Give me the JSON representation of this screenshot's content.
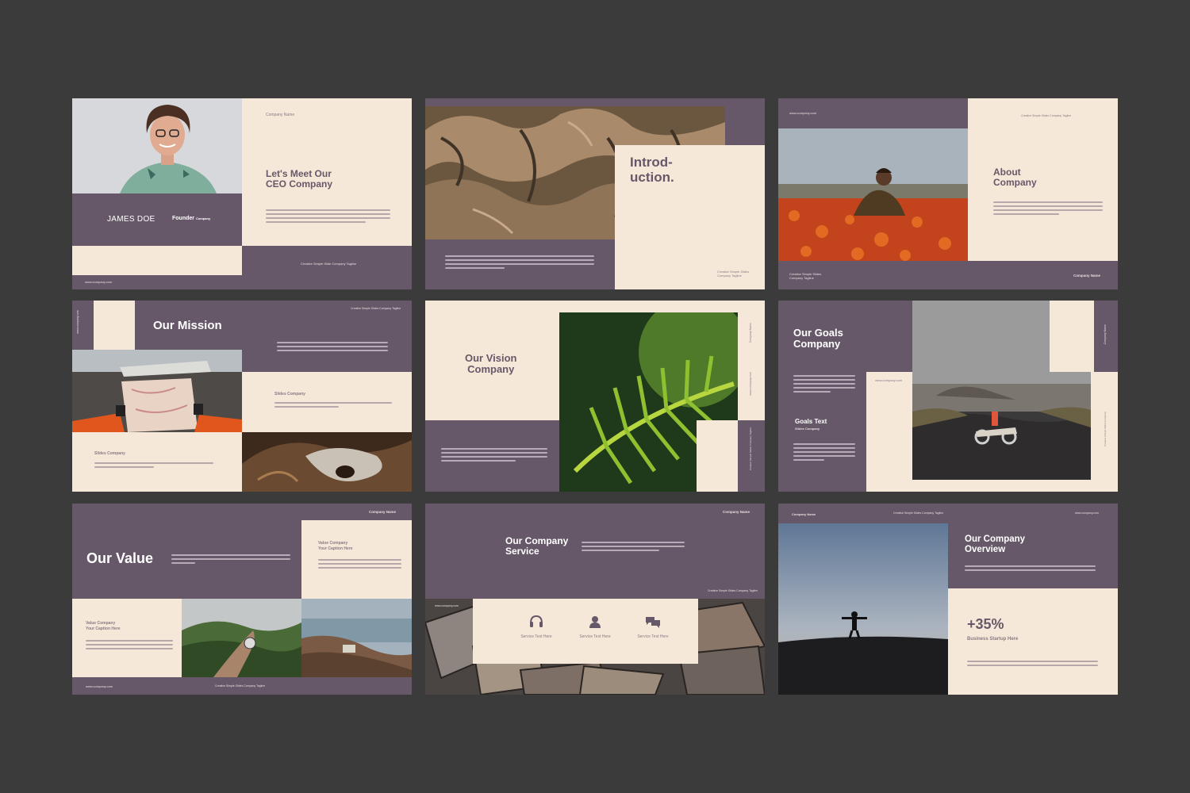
{
  "colors": {
    "background": "#3b3b3b",
    "purple": "#675869",
    "cream": "#f6e8d8"
  },
  "slides": {
    "s1": {
      "company": "Company Name",
      "title_1": "Let's Meet Our",
      "title_2": "CEO Company",
      "name": "JAMES DOE",
      "role": "Founder",
      "role_suffix": "Company",
      "tagline": "Creative Simple Slide Company Tagline",
      "url": "www.company.com"
    },
    "s2": {
      "title_1": "Introd-",
      "title_2": "uction.",
      "tagline_1": "Creative Simple Slides",
      "tagline_2": "Company Tagline"
    },
    "s3": {
      "url": "www.company.com",
      "tagline": "Creative Simple Slides Company Tagline",
      "title_1": "About",
      "title_2": "Company",
      "footer_1": "Creative Simple Slides",
      "footer_2": "Company Tagline",
      "company": "Company Name"
    },
    "s4": {
      "url": "www.company.com",
      "tagline": "Creative Simple Slides Company Tagline",
      "title": "Our Mission",
      "label_1": "Slides Company",
      "label_2": "Slides Company"
    },
    "s5": {
      "title_1": "Our Vision",
      "title_2": "Company",
      "company": "Company Name",
      "url": "www.company.com",
      "tagline": "Creative Simple Slides Company Tagline"
    },
    "s6": {
      "title_1": "Our Goals",
      "title_2": "Company",
      "url": "www.company.com",
      "goals_title": "Goals Text",
      "goals_sub": "Slides Company",
      "company": "Company Name",
      "tagline": "Creative Simple Slides Company"
    },
    "s7": {
      "title": "Our Value",
      "company": "Company Name",
      "caption_1": "Value Company",
      "caption_2": "Your Caption Here",
      "caption_3": "Value Company",
      "caption_4": "Your Caption Here",
      "url": "www.company.com",
      "tagline": "Creative Simple Slides Company Tagline"
    },
    "s8": {
      "title_1": "Our Company",
      "title_2": "Service",
      "company": "Company Name",
      "tagline": "Creative Simple Slides Company Tagline",
      "url": "www.company.com",
      "services": [
        "Service Text Here",
        "Service Text Here",
        "Service Text Here"
      ],
      "icons": [
        "headset-icon",
        "person-icon",
        "chat-icon"
      ]
    },
    "s9": {
      "company": "Company Name",
      "tagline": "Creative Simple Slides Company Tagline",
      "url": "www.company.com",
      "title_1": "Our Company",
      "title_2": "Overview",
      "stat": "+35%",
      "stat_label": "Business Startup Here"
    }
  }
}
